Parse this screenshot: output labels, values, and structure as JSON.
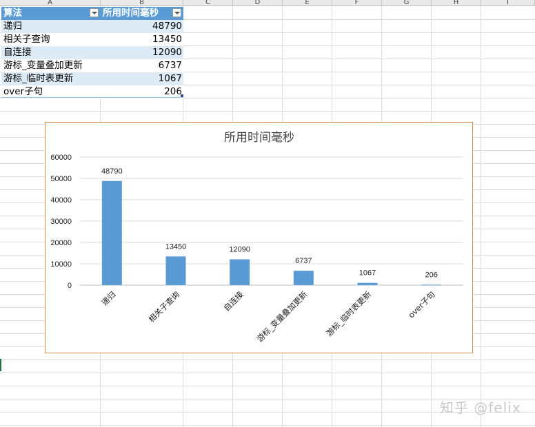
{
  "sheet": {
    "columns": [
      "A",
      "B",
      "C",
      "D",
      "E",
      "F",
      "G",
      "H",
      "I"
    ]
  },
  "table": {
    "headers": [
      "算法",
      "所用时间毫秒"
    ],
    "rows": [
      {
        "name": "递归",
        "value": "48790"
      },
      {
        "name": "相关子查询",
        "value": "13450"
      },
      {
        "name": "自连接",
        "value": "12090"
      },
      {
        "name": "游标_变量叠加更新",
        "value": "6737"
      },
      {
        "name": "游标_临时表更新",
        "value": "1067"
      },
      {
        "name": "over子句",
        "value": "206"
      }
    ]
  },
  "chart_data": {
    "type": "bar",
    "title": "所用时间毫秒",
    "categories": [
      "递归",
      "相关子查询",
      "自连接",
      "游标_变量叠加更新",
      "游标_临时表更新",
      "over子句"
    ],
    "values": [
      48790,
      13450,
      12090,
      6737,
      1067,
      206
    ],
    "ylim": [
      0,
      60000
    ],
    "yticks": [
      0,
      10000,
      20000,
      30000,
      40000,
      50000,
      60000
    ],
    "grid": true,
    "legend": "none",
    "bar_color": "#5b9bd5",
    "border_color": "#d98b4c"
  },
  "watermark": "知乎 @felix"
}
